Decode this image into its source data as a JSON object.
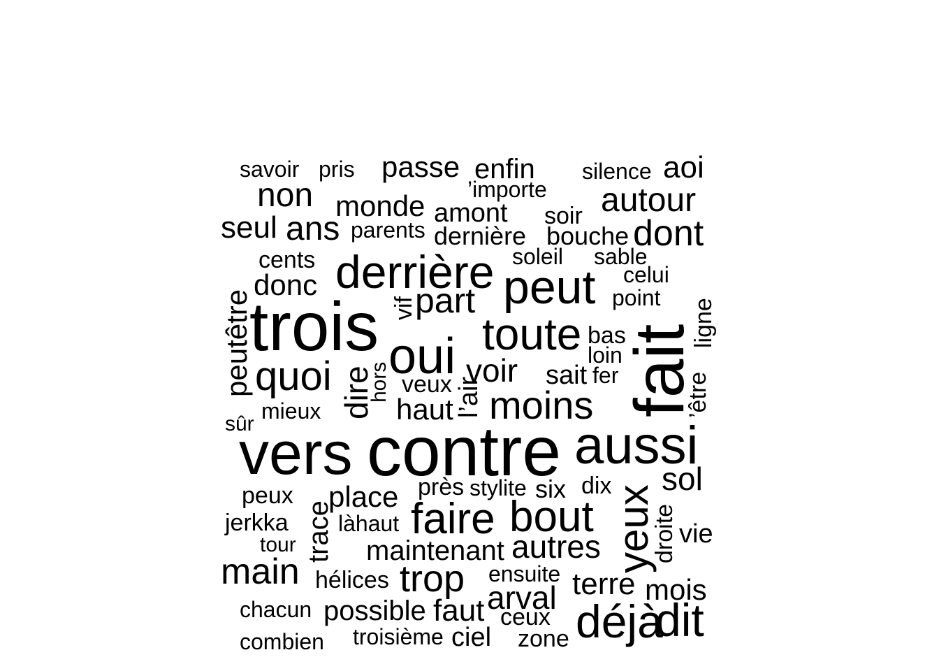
{
  "wordcloud": {
    "text_color": "#000000",
    "background": "#ffffff",
    "words": [
      {
        "text": "savoir"
      },
      {
        "text": "pris"
      },
      {
        "text": "passe"
      },
      {
        "text": "enfin"
      },
      {
        "text": "silence"
      },
      {
        "text": "aoi"
      },
      {
        "text": "’importe"
      },
      {
        "text": "non"
      },
      {
        "text": "monde"
      },
      {
        "text": "amont"
      },
      {
        "text": "soir"
      },
      {
        "text": "autour"
      },
      {
        "text": "seul"
      },
      {
        "text": "ans"
      },
      {
        "text": "parents"
      },
      {
        "text": "dernière"
      },
      {
        "text": "bouche"
      },
      {
        "text": "dont"
      },
      {
        "text": "cents"
      },
      {
        "text": "soleil"
      },
      {
        "text": "sable"
      },
      {
        "text": "derrière"
      },
      {
        "text": "celui"
      },
      {
        "text": "donc"
      },
      {
        "text": "peut"
      },
      {
        "text": "point"
      },
      {
        "text": "peutêtre",
        "orientation": "vertical"
      },
      {
        "text": "vif",
        "orientation": "vertical"
      },
      {
        "text": "part"
      },
      {
        "text": "ligne",
        "orientation": "vertical"
      },
      {
        "text": "trois"
      },
      {
        "text": "toute"
      },
      {
        "text": "bas"
      },
      {
        "text": "fait",
        "orientation": "vertical"
      },
      {
        "text": "oui"
      },
      {
        "text": "loin"
      },
      {
        "text": "quoi"
      },
      {
        "text": "dire",
        "orientation": "vertical"
      },
      {
        "text": "hors",
        "orientation": "vertical"
      },
      {
        "text": "voir"
      },
      {
        "text": "sait"
      },
      {
        "text": "fer"
      },
      {
        "text": "’être",
        "orientation": "vertical"
      },
      {
        "text": "veux"
      },
      {
        "text": "l’air",
        "orientation": "vertical"
      },
      {
        "text": "mieux"
      },
      {
        "text": "haut"
      },
      {
        "text": "moins"
      },
      {
        "text": "sûr"
      },
      {
        "text": "vers"
      },
      {
        "text": "contre"
      },
      {
        "text": "aussi"
      },
      {
        "text": "sol"
      },
      {
        "text": "près"
      },
      {
        "text": "stylite"
      },
      {
        "text": "six"
      },
      {
        "text": "dix"
      },
      {
        "text": "peux"
      },
      {
        "text": "place"
      },
      {
        "text": "yeux",
        "orientation": "vertical"
      },
      {
        "text": "trace",
        "orientation": "vertical"
      },
      {
        "text": "faire"
      },
      {
        "text": "bout"
      },
      {
        "text": "jerkka"
      },
      {
        "text": "làhaut"
      },
      {
        "text": "droite",
        "orientation": "vertical"
      },
      {
        "text": "vie"
      },
      {
        "text": "tour"
      },
      {
        "text": "maintenant"
      },
      {
        "text": "autres"
      },
      {
        "text": "main"
      },
      {
        "text": "ensuite"
      },
      {
        "text": "hélices"
      },
      {
        "text": "trop"
      },
      {
        "text": "terre"
      },
      {
        "text": "mois"
      },
      {
        "text": "arval"
      },
      {
        "text": "chacun"
      },
      {
        "text": "possible"
      },
      {
        "text": "faut"
      },
      {
        "text": "ceux"
      },
      {
        "text": "déjà"
      },
      {
        "text": "dit"
      },
      {
        "text": "combien"
      },
      {
        "text": "troisième"
      },
      {
        "text": "ciel"
      },
      {
        "text": "zone"
      }
    ]
  }
}
